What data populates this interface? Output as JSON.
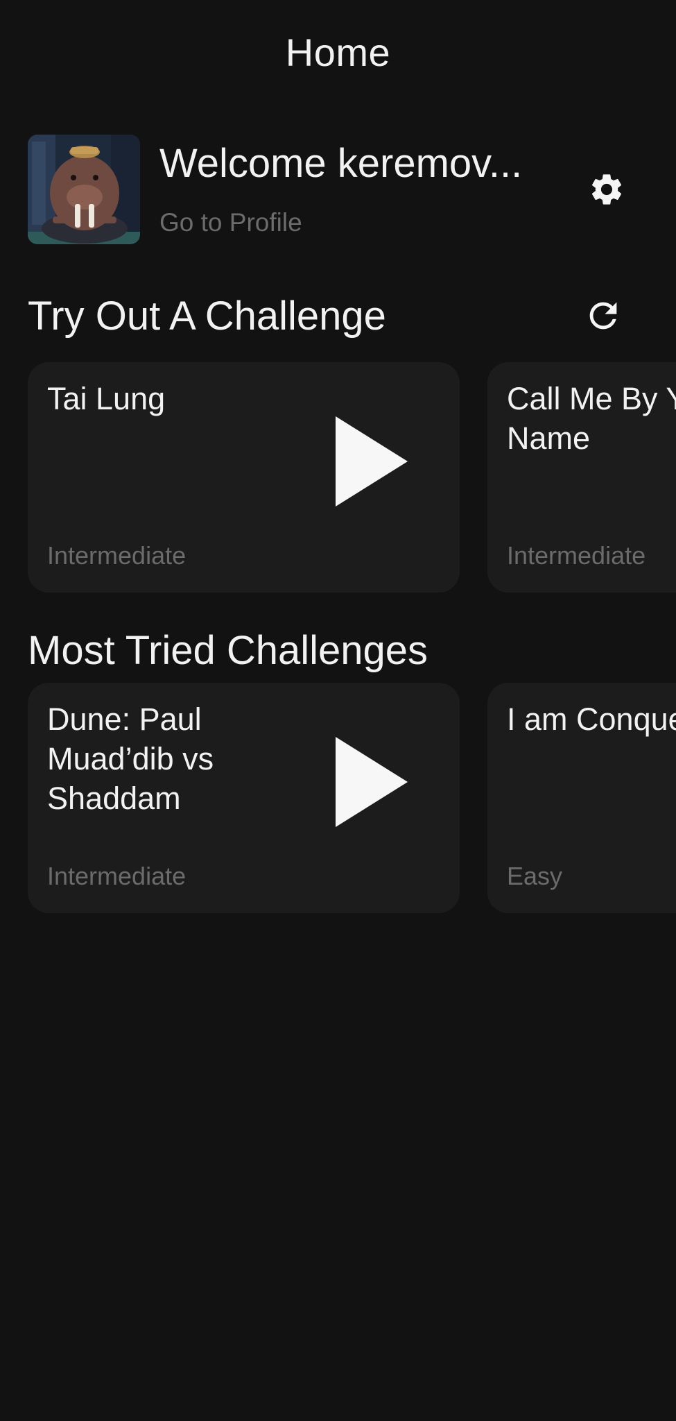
{
  "header": {
    "title": "Home"
  },
  "profile": {
    "welcome": "Welcome keremov...",
    "link": "Go to Profile",
    "avatar_icon": "walrus-avatar",
    "settings_icon": "gear-icon"
  },
  "try_out": {
    "title": "Try Out A Challenge",
    "refresh_icon": "refresh-icon",
    "cards": [
      {
        "title": "Tai Lung",
        "level": "Intermediate"
      },
      {
        "title": "Call Me By Your Name",
        "level": "Intermediate"
      }
    ]
  },
  "most_tried": {
    "title": "Most Tried Challenges",
    "cards": [
      {
        "title": "Dune: Paul Muad’dib vs Shaddam",
        "level": "Intermediate"
      },
      {
        "title": "I am Conquest",
        "level": "Easy"
      }
    ]
  },
  "colors": {
    "background": "#121212",
    "card": "#1c1c1c",
    "muted_text": "#6b6b6b",
    "primary_text": "#f2f2f2"
  }
}
